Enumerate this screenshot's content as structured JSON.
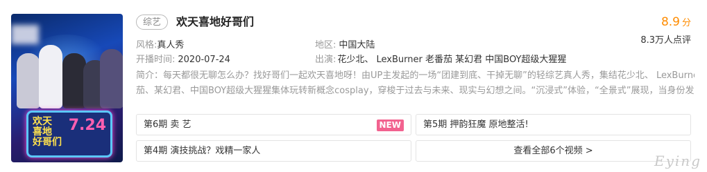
{
  "poster": {
    "logo_text": "欢天喜地好哥们",
    "date": "7.24",
    "tv_text": "欢天\n喜地\n好哥们"
  },
  "show": {
    "category": "综艺",
    "title": "欢天喜地好哥们",
    "score": "8.9",
    "score_unit": "分",
    "reviews": "8.3万人点评"
  },
  "meta": {
    "genre_label": "风格:",
    "genre": "真人秀",
    "region_label": "地区:",
    "region": "中国大陆",
    "airdate_label": "开播时间:",
    "airdate": "2020-07-24",
    "cast_label": "出演:",
    "cast": "花少北、 LexBurner 老番茄 某幻君 中国BOY超级大猩猩"
  },
  "description": {
    "line1": "简介：每天都很无聊怎么办？找好哥们一起欢天喜地呀！由UP主发起的一场“团建到底、干掉无聊”的轻综艺真人秀，集结花少北、 LexBurner、老番",
    "line2": "茄、某幻君、中国BOY超级大猩猩集体玩转新概念cosplay，穿梭于过去与未来、现实与幻想之间。“沉浸式”体验，“全景式”展现，当身份发生改变时，..."
  },
  "episodes": [
    {
      "label": "第6期 卖 艺",
      "badge": "NEW"
    },
    {
      "label": "第5期 押韵狂魔 原地整活!"
    },
    {
      "label": "第4期 演技挑战？戏精一家人"
    }
  ],
  "view_all": "查看全部6个视频 >",
  "watermark": "Eying"
}
